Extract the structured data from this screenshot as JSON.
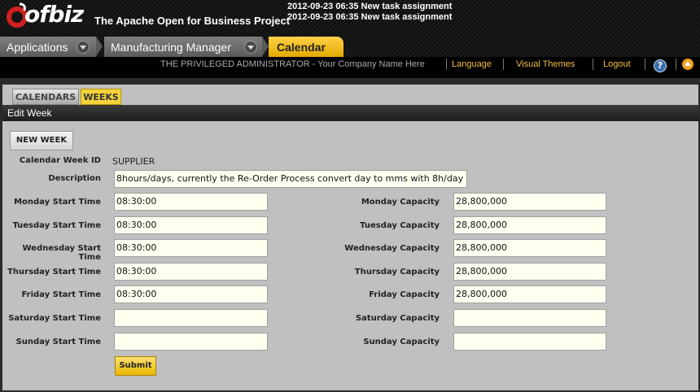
{
  "header": {
    "logo_text": "ofbiz",
    "tagline": "The Apache Open for Business Project",
    "notifications": [
      "2012-09-23 06:35 New task assignment",
      "2012-09-23 06:35 New task assignment"
    ]
  },
  "app_tabs": [
    {
      "label": "Applications"
    },
    {
      "label": "Manufacturing Manager"
    },
    {
      "label": "Calendar",
      "active": true
    }
  ],
  "userbar": {
    "admin_text": "THE PRIVILEGED ADMINISTRATOR - Your Company Name Here",
    "links": [
      "Language",
      "Visual Themes",
      "Logout"
    ],
    "help_symbol": "?"
  },
  "subtabs": {
    "calendars": "CALENDARS",
    "weeks": "WEEKS"
  },
  "page_title": "Edit Week",
  "buttons": {
    "new_week": "NEW WEEK",
    "submit": "Submit"
  },
  "form": {
    "calendar_week_id_label": "Calendar Week ID",
    "calendar_week_id": "SUPPLIER",
    "description_label": "Description",
    "description": "8hours/days, currently the Re-Order Process convert day to mms with 8h/day",
    "days": [
      {
        "start_label": "Monday Start Time",
        "start": "08:30:00",
        "cap_label": "Monday Capacity",
        "cap": "28,800,000"
      },
      {
        "start_label": "Tuesday Start Time",
        "start": "08:30:00",
        "cap_label": "Tuesday Capacity",
        "cap": "28,800,000"
      },
      {
        "start_label": "Wednesday Start Time",
        "start": "08:30:00",
        "cap_label": "Wednesday Capacity",
        "cap": "28,800,000"
      },
      {
        "start_label": "Thursday Start Time",
        "start": "08:30:00",
        "cap_label": "Thursday Capacity",
        "cap": "28,800,000"
      },
      {
        "start_label": "Friday Start Time",
        "start": "08:30:00",
        "cap_label": "Friday Capacity",
        "cap": "28,800,000"
      },
      {
        "start_label": "Saturday Start Time",
        "start": "",
        "cap_label": "Saturday Capacity",
        "cap": ""
      },
      {
        "start_label": "Sunday Start Time",
        "start": "",
        "cap_label": "Sunday Capacity",
        "cap": ""
      }
    ]
  },
  "colors": {
    "accent": "#f5c518",
    "link": "#f0c040",
    "input_bg": "#fffff0",
    "panel_bg": "#c0c0c0"
  },
  "icons": [
    "ofbiz-logo-icon",
    "dropdown-arrow-icon",
    "help-icon",
    "scroll-up-icon"
  ]
}
